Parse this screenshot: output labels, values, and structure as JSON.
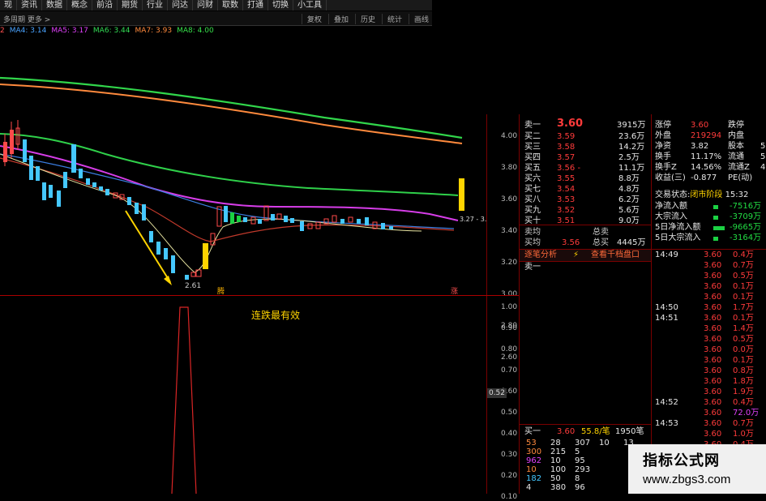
{
  "menu": [
    "现",
    "资讯",
    "数据",
    "概念",
    "前沿",
    "期货",
    "行业",
    "问达",
    "问财",
    "取数",
    "打通",
    "切换",
    "小工具"
  ],
  "subbar": {
    "left": "多周期  更多 >",
    "right": [
      "复权",
      "叠加",
      "历史",
      "统计",
      "画线"
    ]
  },
  "ma_legend": [
    {
      "label": "2",
      "color": "#ff5050"
    },
    {
      "label": "MA4: 3.14",
      "color": "#4aa3ff"
    },
    {
      "label": "MA5: 3.17",
      "color": "#e040fb"
    },
    {
      "label": "MA6: 3.44",
      "color": "#33dd55"
    },
    {
      "label": "MA7: 3.93",
      "color": "#ff8a3d"
    },
    {
      "label": "MA8: 4.00",
      "color": "#36e04a"
    }
  ],
  "price_axis": [
    "4.00",
    "3.80",
    "3.60",
    "3.40",
    "3.20",
    "3.00",
    "2.80",
    "2.60"
  ],
  "price_marks": {
    "low_label": "2.61",
    "right_label": "3.27 - 3.",
    "bottom_left_tag": "腾",
    "bottom_right_tag": "涨"
  },
  "indicator": {
    "title": "连跌最有效",
    "axis": [
      "1.00",
      "0.90",
      "0.80",
      "0.70",
      "0.60",
      "0.50",
      "0.40",
      "0.30",
      "0.20",
      "0.10"
    ],
    "current": "0.52"
  },
  "order_book": {
    "sell_header": "卖一",
    "sell_price": "3.60",
    "sell_vol": "3915万",
    "buy_rows": [
      {
        "label": "买二",
        "price": "3.59",
        "vol": "23.6万"
      },
      {
        "label": "买三",
        "price": "3.58",
        "vol": "14.2万"
      },
      {
        "label": "买四",
        "price": "3.57",
        "vol": "2.5万"
      },
      {
        "label": "买五",
        "price": "3.56 -",
        "vol": "11.1万"
      },
      {
        "label": "买六",
        "price": "3.55",
        "vol": "8.8万"
      },
      {
        "label": "买七",
        "price": "3.54",
        "vol": "4.8万"
      },
      {
        "label": "买八",
        "price": "3.53",
        "vol": "6.2万"
      },
      {
        "label": "买九",
        "price": "3.52",
        "vol": "5.6万"
      },
      {
        "label": "买十",
        "price": "3.51",
        "vol": "9.0万"
      }
    ],
    "sell_avg_label": "卖均",
    "total_sell_label": "总卖",
    "buy_avg_label": "买均",
    "buy_avg": "3.56",
    "total_buy_label": "总买",
    "total_buy": "4445万",
    "tab_left": "逐笔分析",
    "tab_right": "查看千档盘口",
    "sell1": "卖一",
    "bottom": {
      "label": "买一",
      "price": "3.60",
      "vol": "55.8/笔",
      "count": "1950笔"
    },
    "queue": [
      [
        "53",
        "28",
        "307",
        "10",
        "13"
      ],
      [
        "300",
        "215",
        "5",
        "",
        ""
      ],
      [
        "962",
        "10",
        "95",
        "",
        ""
      ],
      [
        "10",
        "100",
        "293",
        "",
        ""
      ],
      [
        "182",
        "50",
        "8",
        "",
        ""
      ],
      [
        "4",
        "380",
        "96",
        "",
        ""
      ]
    ]
  },
  "stats": {
    "rows": [
      {
        "a": "涨停",
        "b": "3.60",
        "c": "跌停",
        "d": ""
      },
      {
        "a": "外盘",
        "b": "219294",
        "c": "内盘",
        "d": ""
      },
      {
        "a": "净资",
        "b": "3.82",
        "c": "股本",
        "d": "5"
      },
      {
        "a": "换手",
        "b": "11.17%",
        "c": "流通",
        "d": "5"
      },
      {
        "a": "换手Z",
        "b": "14.56%",
        "c": "流通Z",
        "d": "4"
      },
      {
        "a": "收益(三)",
        "b": "-0.877",
        "c": "PE(动)",
        "d": ""
      }
    ],
    "status_label": "交易状态:",
    "status_value": "闭市阶段",
    "status_time": "15:32",
    "flows": [
      {
        "label": "净流入额",
        "value": "-7516万"
      },
      {
        "label": "大宗流入",
        "value": "-3709万"
      },
      {
        "label": "5日净流入额",
        "value": "-9665万"
      },
      {
        "label": "5日大宗流入",
        "value": "-3164万"
      }
    ]
  },
  "ticks": [
    {
      "time": "14:49",
      "price": "3.60",
      "vol": "0.4万"
    },
    {
      "time": "",
      "price": "3.60",
      "vol": "0.7万"
    },
    {
      "time": "",
      "price": "3.60",
      "vol": "0.5万"
    },
    {
      "time": "",
      "price": "3.60",
      "vol": "0.1万"
    },
    {
      "time": "",
      "price": "3.60",
      "vol": "0.1万"
    },
    {
      "time": "14:50",
      "price": "3.60",
      "vol": "1.7万"
    },
    {
      "time": "14:51",
      "price": "3.60",
      "vol": "0.1万"
    },
    {
      "time": "",
      "price": "3.60",
      "vol": "1.4万"
    },
    {
      "time": "",
      "price": "3.60",
      "vol": "0.5万"
    },
    {
      "time": "",
      "price": "3.60",
      "vol": "0.0万"
    },
    {
      "time": "",
      "price": "3.60",
      "vol": "0.1万"
    },
    {
      "time": "",
      "price": "3.60",
      "vol": "0.8万"
    },
    {
      "time": "",
      "price": "3.60",
      "vol": "1.8万"
    },
    {
      "time": "",
      "price": "3.60",
      "vol": "1.9万"
    },
    {
      "time": "14:52",
      "price": "3.60",
      "vol": "0.4万"
    },
    {
      "time": "",
      "price": "3.60",
      "vol": "72.0万"
    },
    {
      "time": "14:53",
      "price": "3.60",
      "vol": "0.7万"
    },
    {
      "time": "",
      "price": "3.60",
      "vol": "1.0万"
    },
    {
      "time": "",
      "price": "3.60",
      "vol": "0.4万"
    }
  ],
  "watermark": {
    "title": "指标公式网",
    "url": "www.zbgs3.com"
  }
}
